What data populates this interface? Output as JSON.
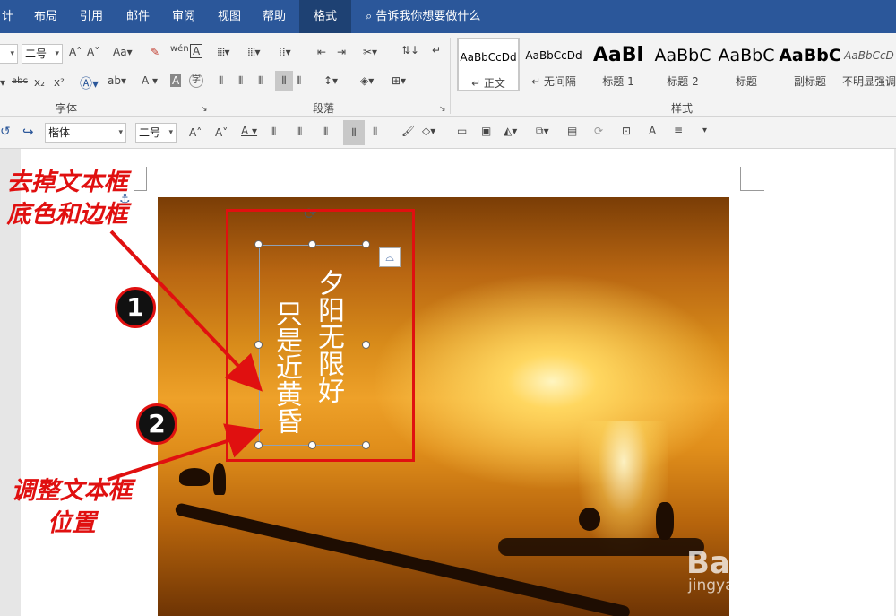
{
  "tabs": [
    {
      "label": "计"
    },
    {
      "label": "布局"
    },
    {
      "label": "引用"
    },
    {
      "label": "邮件"
    },
    {
      "label": "审阅"
    },
    {
      "label": "视图"
    },
    {
      "label": "帮助"
    },
    {
      "label": "格式"
    }
  ],
  "tell_me": "告诉我你想要做什么",
  "ribbon": {
    "font_size_value": "二号",
    "font_group_label": "字体",
    "paragraph_group_label": "段落",
    "styles_group_label": "样式",
    "styles": [
      {
        "sample": "AaBbCcDd",
        "name": "↵ 正文"
      },
      {
        "sample": "AaBbCcDd",
        "name": "↵ 无间隔"
      },
      {
        "sample": "AaBl",
        "name": "标题 1"
      },
      {
        "sample": "AaBbC",
        "name": "标题 2"
      },
      {
        "sample": "AaBbC",
        "name": "标题"
      },
      {
        "sample": "AaBbC",
        "name": "副标题"
      },
      {
        "sample": "AaBbCcD",
        "name": "不明显强调"
      }
    ]
  },
  "mini_toolbar": {
    "font_name": "楷体",
    "font_size": "二号"
  },
  "document": {
    "poem_col1": "夕阳无限好",
    "poem_col2": "只是近黄昏"
  },
  "annotations": {
    "note1": "去掉文本框底色和边框",
    "note2": "调整文本框位置",
    "badge1": "1",
    "badge2": "2"
  },
  "watermark": {
    "brand": "Bai du 经验",
    "url": "jingyan.baidu.com"
  }
}
